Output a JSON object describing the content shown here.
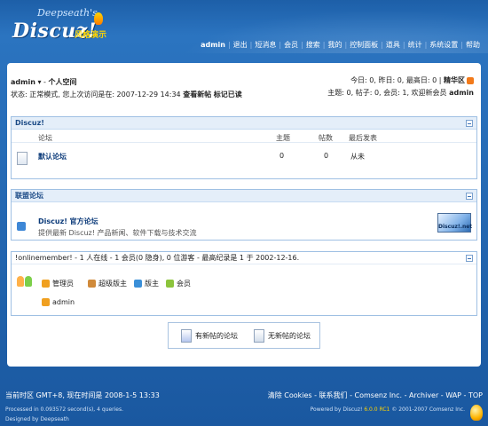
{
  "logo": {
    "script": "Deepseath's",
    "main": "Discuz!",
    "sub": "风格演示"
  },
  "topnav": {
    "items": [
      "admin",
      "退出",
      "短消息",
      "会员",
      "搜索",
      "我的",
      "控制面板",
      "道具",
      "统计",
      "系统设置",
      "帮助"
    ]
  },
  "userinfo": {
    "username": "admin",
    "space": "个人空间",
    "status_prefix": "状态: 正常模式, 您上次访问是在: 2007-12-29 14:34",
    "view_new": "查看新帖",
    "mark_read": "标记已读",
    "stats1": "今日: 0, 昨日: 0, 最高日: 0",
    "digest": "精华区",
    "stats2_prefix": "主题: 0, 帖子: 0, 会员: 1, 欢迎新会员",
    "new_member": "admin"
  },
  "category": {
    "title": "Discuz!",
    "columns": {
      "forum": "论坛",
      "topics": "主题",
      "posts": "帖数",
      "last": "最后发表"
    },
    "forums": [
      {
        "name": "默认论坛",
        "topics": "0",
        "posts": "0",
        "last": "从未"
      }
    ]
  },
  "links": {
    "title": "联盟论坛",
    "name": "Discuz! 官方论坛",
    "desc": "提供最新 Discuz! 产品新闻、软件下载与技术交流",
    "logo_text": "Discuz!.net"
  },
  "online": {
    "title": "!onlinemember! - 1 人在线 - 1 会员(0 隐身), 0 位游客 - 最高纪录是 1 于 2002-12-16.",
    "groups": [
      {
        "label": "管理员",
        "color": "#f0a020"
      },
      {
        "label": "超级版主",
        "color": "#d08a3a"
      },
      {
        "label": "版主",
        "color": "#3a8fd8"
      },
      {
        "label": "会员",
        "color": "#8cc43c"
      }
    ],
    "users": [
      "admin"
    ]
  },
  "legend": {
    "new": "有新帖的论坛",
    "none": "无新帖的论坛"
  },
  "footer": {
    "time": "当前时区 GMT+8, 现在时间是 2008-1-5 13:33",
    "links": "清除 Cookies - 联系我们 - Comsenz Inc. - Archiver - WAP - TOP",
    "processed": "Processed in 0.093572 second(s), 4 queries.",
    "designed": "Designed by Deepseath",
    "powered_prefix": "Powered by Discuz!",
    "version": "6.0.0 RC1",
    "copyright": "© 2001-2007 Comsenz Inc."
  }
}
